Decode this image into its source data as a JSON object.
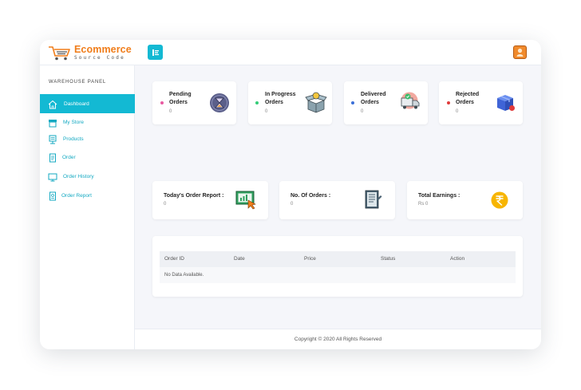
{
  "brand": {
    "name": "Ecommerce",
    "tagline": "Source Code",
    "accent": "#13b9d3",
    "orange": "#f07d1a"
  },
  "sidebar": {
    "panel_title": "WAREHOUSE PANEL",
    "items": [
      {
        "label": "Dashboard",
        "icon": "home-icon",
        "active": true
      },
      {
        "label": "My Store",
        "icon": "store-icon",
        "active": false
      },
      {
        "label": "Products",
        "icon": "products-icon",
        "active": false
      },
      {
        "label": "Order",
        "icon": "order-icon",
        "active": false
      },
      {
        "label": "Order History",
        "icon": "monitor-icon",
        "active": false
      },
      {
        "label": "Order Report",
        "icon": "report-icon",
        "active": false
      }
    ]
  },
  "stats": [
    {
      "title_line1": "Pending",
      "title_line2": "Orders",
      "value": "0",
      "dot_color": "#e85aa1",
      "icon": "hourglass-icon"
    },
    {
      "title_line1": "In Progress",
      "title_line2": "Orders",
      "value": "0",
      "dot_color": "#33cc77",
      "icon": "open-box-icon"
    },
    {
      "title_line1": "Delivered",
      "title_line2": "Orders",
      "value": "0",
      "dot_color": "#3a6fd8",
      "icon": "delivery-truck-icon"
    },
    {
      "title_line1": "Rejected",
      "title_line2": "Orders",
      "value": "0",
      "dot_color": "#e03a3a",
      "icon": "rejected-box-icon"
    }
  ],
  "summary": [
    {
      "title": "Today's Order Report :",
      "value": "0",
      "icon": "report-chart-icon"
    },
    {
      "title": "No. Of Orders :",
      "value": "0",
      "icon": "document-icon"
    },
    {
      "title": "Total Earnings :",
      "value": "Rs 0",
      "icon": "rupee-icon"
    }
  ],
  "table": {
    "columns": [
      "Order ID",
      "Date",
      "Price",
      "Status",
      "Action"
    ],
    "empty_text": "No Data Available."
  },
  "footer": {
    "text": "Copyright © 2020 All Rights Reserved"
  }
}
